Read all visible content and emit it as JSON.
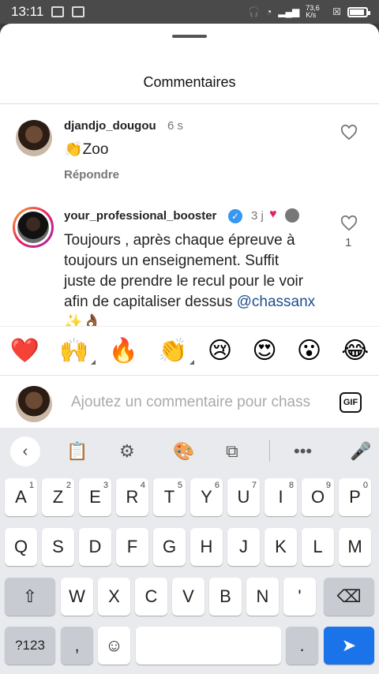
{
  "status_bar": {
    "time": "13:11",
    "net_speed": "73,6 K/s"
  },
  "sheet": {
    "title": "Commentaires"
  },
  "comments": [
    {
      "username": "djandjo_dougou",
      "time": "6 s",
      "text": "👏Zoo",
      "reply_label": "Répondre"
    },
    {
      "username": "your_professional_booster",
      "time": "3 j",
      "text_lines": [
        "Toujours , après chaque épreuve à",
        "toujours un enseignement. Suffit",
        "juste de prendre le recul pour le voir",
        "afin de capitaliser dessus"
      ],
      "mention": "@chassanx",
      "last_line": "✨👌🏾",
      "likes": "1"
    }
  ],
  "emoji_bar": [
    "❤️",
    "🙌",
    "🔥",
    "👏",
    "😢",
    "😍",
    "😮",
    "😂"
  ],
  "composer": {
    "placeholder": "Ajoutez un commentaire pour chass",
    "gif_label": "GIF"
  },
  "keyboard": {
    "row1": [
      {
        "k": "A",
        "s": "1"
      },
      {
        "k": "Z",
        "s": "2"
      },
      {
        "k": "E",
        "s": "3"
      },
      {
        "k": "R",
        "s": "4"
      },
      {
        "k": "T",
        "s": "5"
      },
      {
        "k": "Y",
        "s": "6"
      },
      {
        "k": "U",
        "s": "7"
      },
      {
        "k": "I",
        "s": "8"
      },
      {
        "k": "O",
        "s": "9"
      },
      {
        "k": "P",
        "s": "0"
      }
    ],
    "row2": [
      "Q",
      "S",
      "D",
      "F",
      "G",
      "H",
      "J",
      "K",
      "L",
      "M"
    ],
    "row3": [
      "W",
      "X",
      "C",
      "V",
      "B",
      "N",
      "'"
    ],
    "sym_label": "?123",
    "comma": ",",
    "period": "."
  }
}
